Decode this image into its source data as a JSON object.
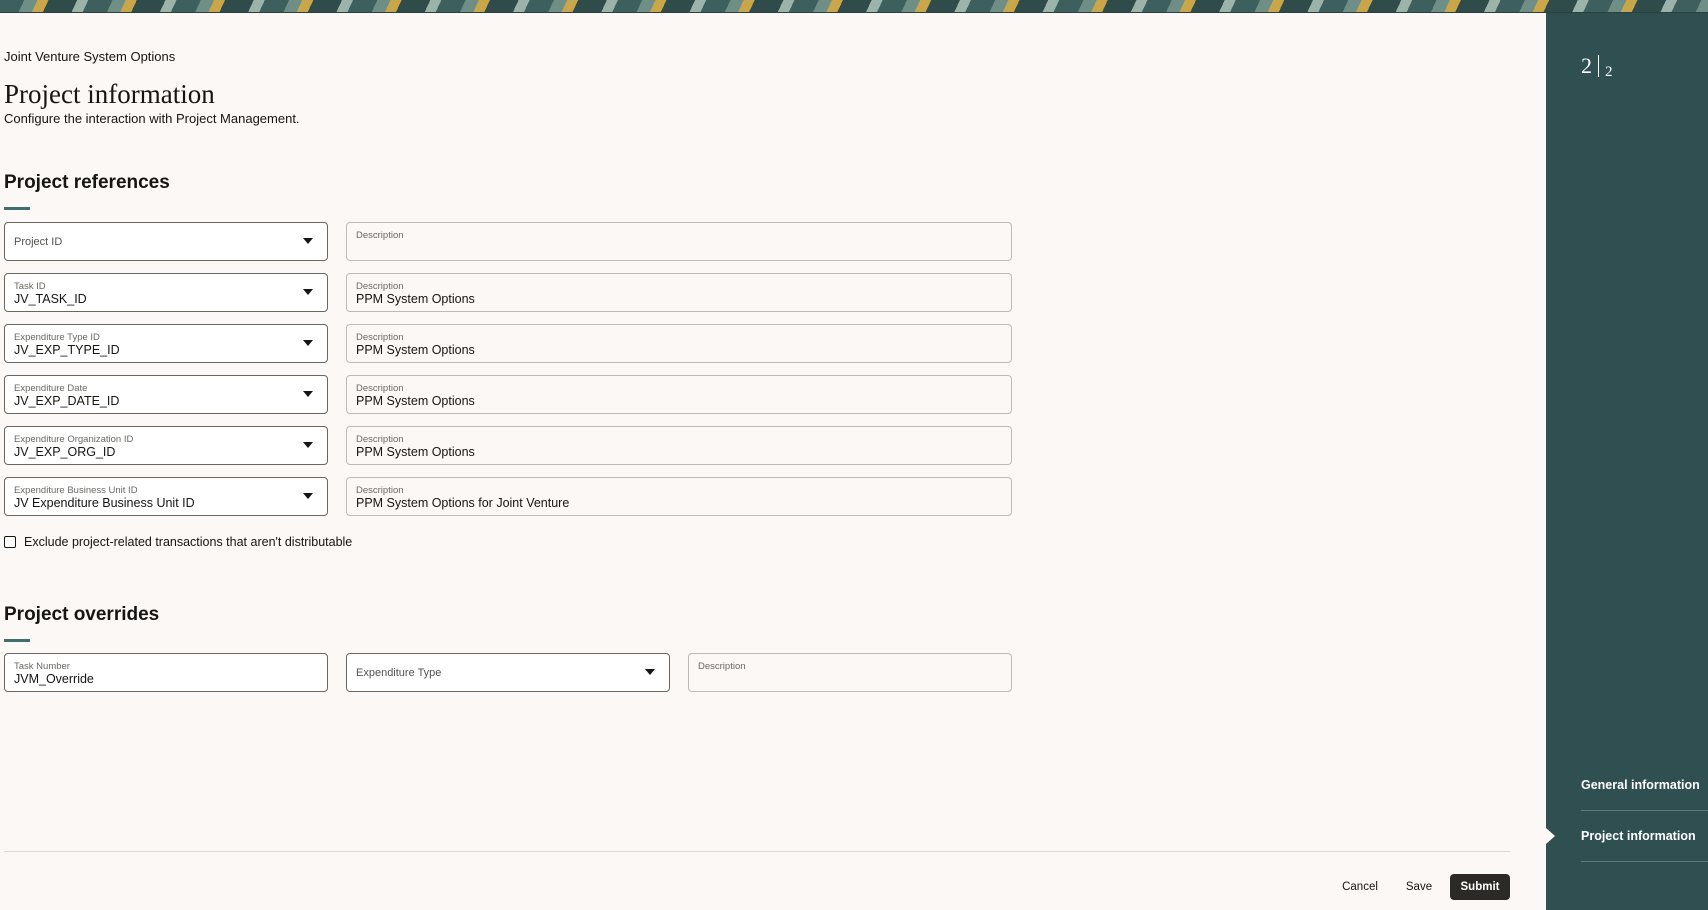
{
  "breadcrumb": "Joint Venture System Options",
  "page": {
    "title": "Project information",
    "subtitle": "Configure the interaction with Project Management."
  },
  "references": {
    "title": "Project references",
    "rows": [
      {
        "id_label": "Project ID",
        "id_value": "",
        "desc_label": "Description",
        "desc_value": ""
      },
      {
        "id_label": "Task ID",
        "id_value": "JV_TASK_ID",
        "desc_label": "Description",
        "desc_value": "PPM System Options"
      },
      {
        "id_label": "Expenditure Type ID",
        "id_value": "JV_EXP_TYPE_ID",
        "desc_label": "Description",
        "desc_value": "PPM System Options"
      },
      {
        "id_label": "Expenditure Date",
        "id_value": "JV_EXP_DATE_ID",
        "desc_label": "Description",
        "desc_value": "PPM System Options"
      },
      {
        "id_label": "Expenditure Organization ID",
        "id_value": "JV_EXP_ORG_ID",
        "desc_label": "Description",
        "desc_value": "PPM System Options"
      },
      {
        "id_label": "Expenditure Business Unit ID",
        "id_value": "JV Expenditure Business Unit ID",
        "desc_label": "Description",
        "desc_value": "PPM System Options for Joint Venture"
      }
    ],
    "exclude_label": "Exclude project-related transactions that aren't distributable"
  },
  "overrides": {
    "title": "Project overrides",
    "task_number_label": "Task Number",
    "task_number_value": "JVM_Override",
    "expenditure_type_label": "Expenditure Type",
    "description_label": "Description"
  },
  "footer": {
    "cancel": "Cancel",
    "save": "Save",
    "submit": "Submit"
  },
  "rail": {
    "current_step": "2",
    "total_steps": "2",
    "items": [
      "General information",
      "Project information"
    ]
  },
  "colors": {
    "rail_bg": "#2f4f50",
    "accent": "#3e6f6c",
    "primary_button": "#2c2a27"
  }
}
